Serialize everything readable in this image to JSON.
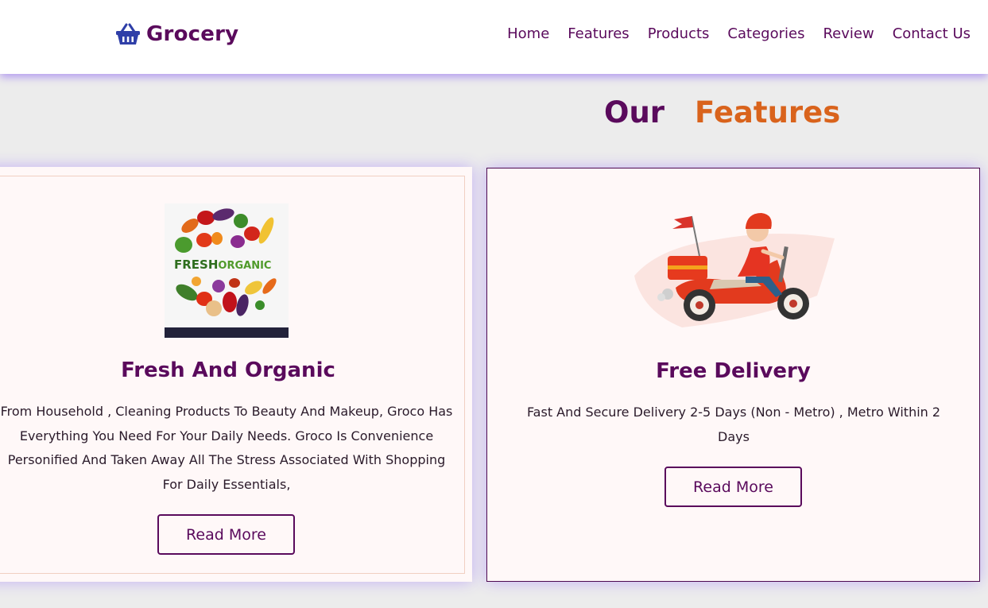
{
  "header": {
    "brand": "Grocery",
    "logo_icon": "basket-icon",
    "nav": [
      "Home",
      "Features",
      "Products",
      "Categories",
      "Review",
      "Contact Us"
    ]
  },
  "section": {
    "title_word1": "Our",
    "title_word2": "Features"
  },
  "cards": [
    {
      "image": "fresh-organic-vegetables-image",
      "image_text_fresh": "FRESH",
      "image_text_organic": "ORGANIC",
      "title": "Fresh And Organic",
      "text": "From Household , Cleaning Products To Beauty And Makeup, Groco Has Everything You Need For Your Daily Needs. Groco Is Convenience Personified And Taken Away All The Stress Associated With Shopping For Daily Essentials,",
      "button": "Read More"
    },
    {
      "image": "delivery-scooter-image",
      "title": "Free Delivery",
      "text": "Fast And Secure Delivery 2-5 Days (Non - Metro) , Metro Within 2 Days",
      "button": "Read More"
    }
  ],
  "colors": {
    "brand": "#5a0a5c",
    "accent": "#d9631c",
    "shadow": "#b39bf0",
    "card_bg": "#fff8f8"
  }
}
